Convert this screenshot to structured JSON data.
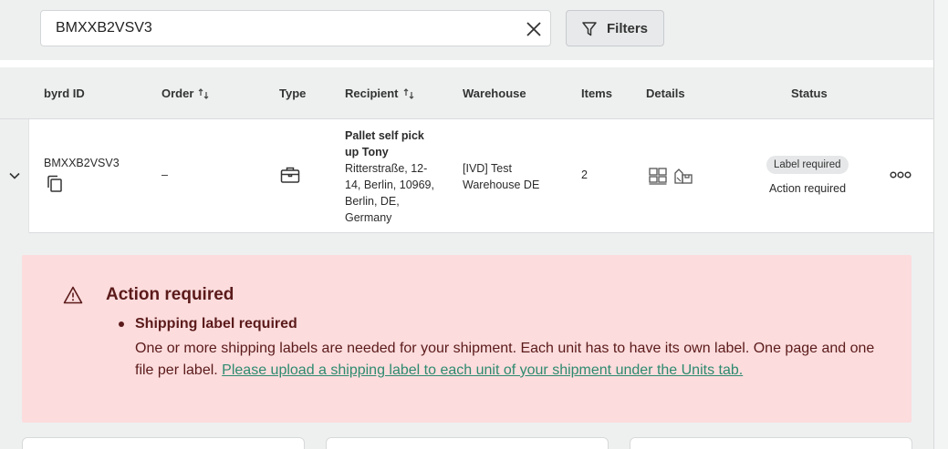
{
  "search": {
    "value": "BMXXB2VSV3",
    "placeholder": ""
  },
  "filters": {
    "label": "Filters"
  },
  "table": {
    "headers": {
      "byrd_id": "byrd ID",
      "order": "Order",
      "type": "Type",
      "recipient": "Recipient",
      "warehouse": "Warehouse",
      "items": "Items",
      "details": "Details",
      "status": "Status"
    },
    "row": {
      "byrd_id": "BMXXB2VSV3",
      "order": "–",
      "recipient_name_line1": "Pallet self pick",
      "recipient_name_line2": "up Tony",
      "recipient_addr_1": "Ritterstraße, 12-",
      "recipient_addr_2": "14, Berlin, 10969,",
      "recipient_addr_3": "Berlin, DE,",
      "recipient_addr_4": "Germany",
      "warehouse_line1": "[IVD] Test",
      "warehouse_line2": "Warehouse DE",
      "items": "2",
      "status_badge": "Label required",
      "status_sub": "Action required"
    }
  },
  "alert": {
    "title": "Action required",
    "bullet_title": "Shipping label required",
    "text": "One or more shipping labels are needed for your shipment. Each unit has to have its own label. One page and one file per label.",
    "link": "Please upload a shipping label to each unit of your shipment under the Units tab."
  },
  "icons": {
    "clear": "close-icon",
    "filter": "funnel-icon",
    "sort": "sort-icon",
    "expand": "chevron-down-icon",
    "copy": "copy-icon",
    "type": "briefcase-icon",
    "details_1": "pallet-icon",
    "details_2": "boxes-icon",
    "more": "more-horizontal-icon",
    "warning": "warning-icon"
  },
  "colors": {
    "alert_bg": "#fcdcdd",
    "alert_text": "#5b1a1a",
    "link": "#2d8a6f",
    "page_bg": "#eef0f0"
  }
}
